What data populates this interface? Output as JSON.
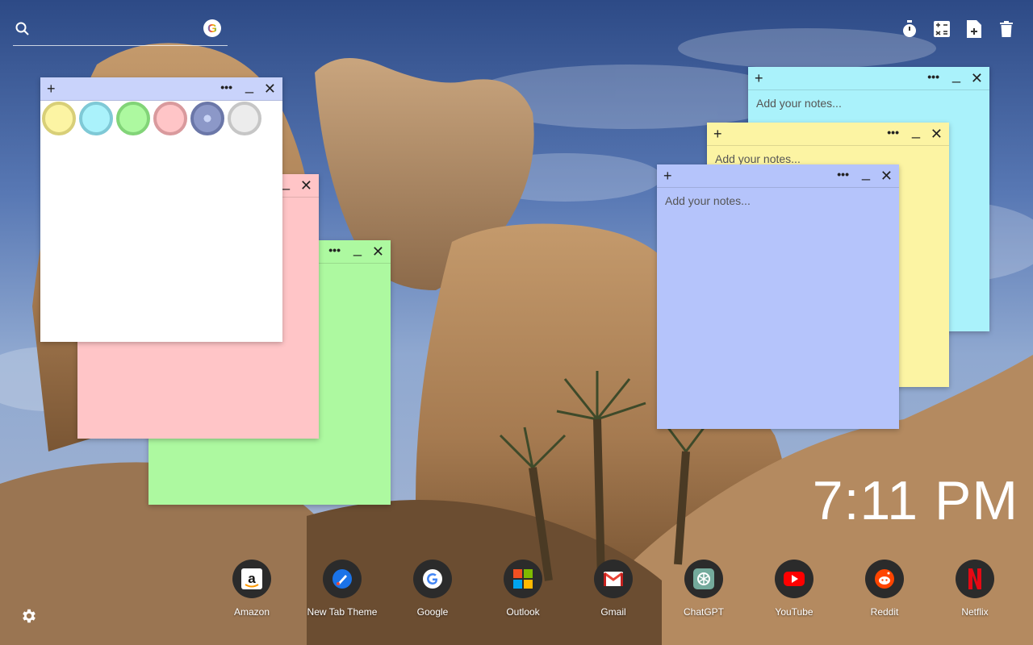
{
  "search": {
    "placeholder": "",
    "engine_badge": "G"
  },
  "toolbar": {
    "icons": [
      "timer-icon",
      "calculator-icon",
      "new-note-icon",
      "trash-icon"
    ]
  },
  "notes": {
    "white": {
      "plus": "+",
      "more": "•••",
      "min": "_",
      "close": "✕",
      "color": "#ffffff"
    },
    "pink": {
      "min": "_",
      "close": "✕",
      "color": "#ffc5c7"
    },
    "green": {
      "more": "•••",
      "min": "_",
      "close": "✕",
      "color": "#adf9a0"
    },
    "cyan": {
      "plus": "+",
      "more": "•••",
      "min": "_",
      "close": "✕",
      "placeholder": "Add your notes...",
      "color": "#aaf2fb"
    },
    "yellow": {
      "plus": "+",
      "more": "•••",
      "min": "_",
      "close": "✕",
      "placeholder": "Add your notes...",
      "color": "#fcf4a3"
    },
    "blue": {
      "plus": "+",
      "more": "•••",
      "min": "_",
      "close": "✕",
      "placeholder": "Add your notes...",
      "color": "#b5c4fb"
    }
  },
  "palette": [
    "#fcf4a3",
    "#aaf2fb",
    "#adf9a0",
    "#ffc5c7",
    "#8c98c8",
    "#e8e8e8"
  ],
  "clock": {
    "time": "7:11 PM"
  },
  "shortcuts": [
    {
      "label": "Amazon",
      "icon": "amazon-icon"
    },
    {
      "label": "New Tab Theme",
      "icon": "new-tab-theme-icon"
    },
    {
      "label": "Google",
      "icon": "google-icon"
    },
    {
      "label": "Outlook",
      "icon": "outlook-icon"
    },
    {
      "label": "Gmail",
      "icon": "gmail-icon"
    },
    {
      "label": "ChatGPT",
      "icon": "chatgpt-icon"
    },
    {
      "label": "YouTube",
      "icon": "youtube-icon"
    },
    {
      "label": "Reddit",
      "icon": "reddit-icon"
    },
    {
      "label": "Netflix",
      "icon": "netflix-icon"
    }
  ]
}
